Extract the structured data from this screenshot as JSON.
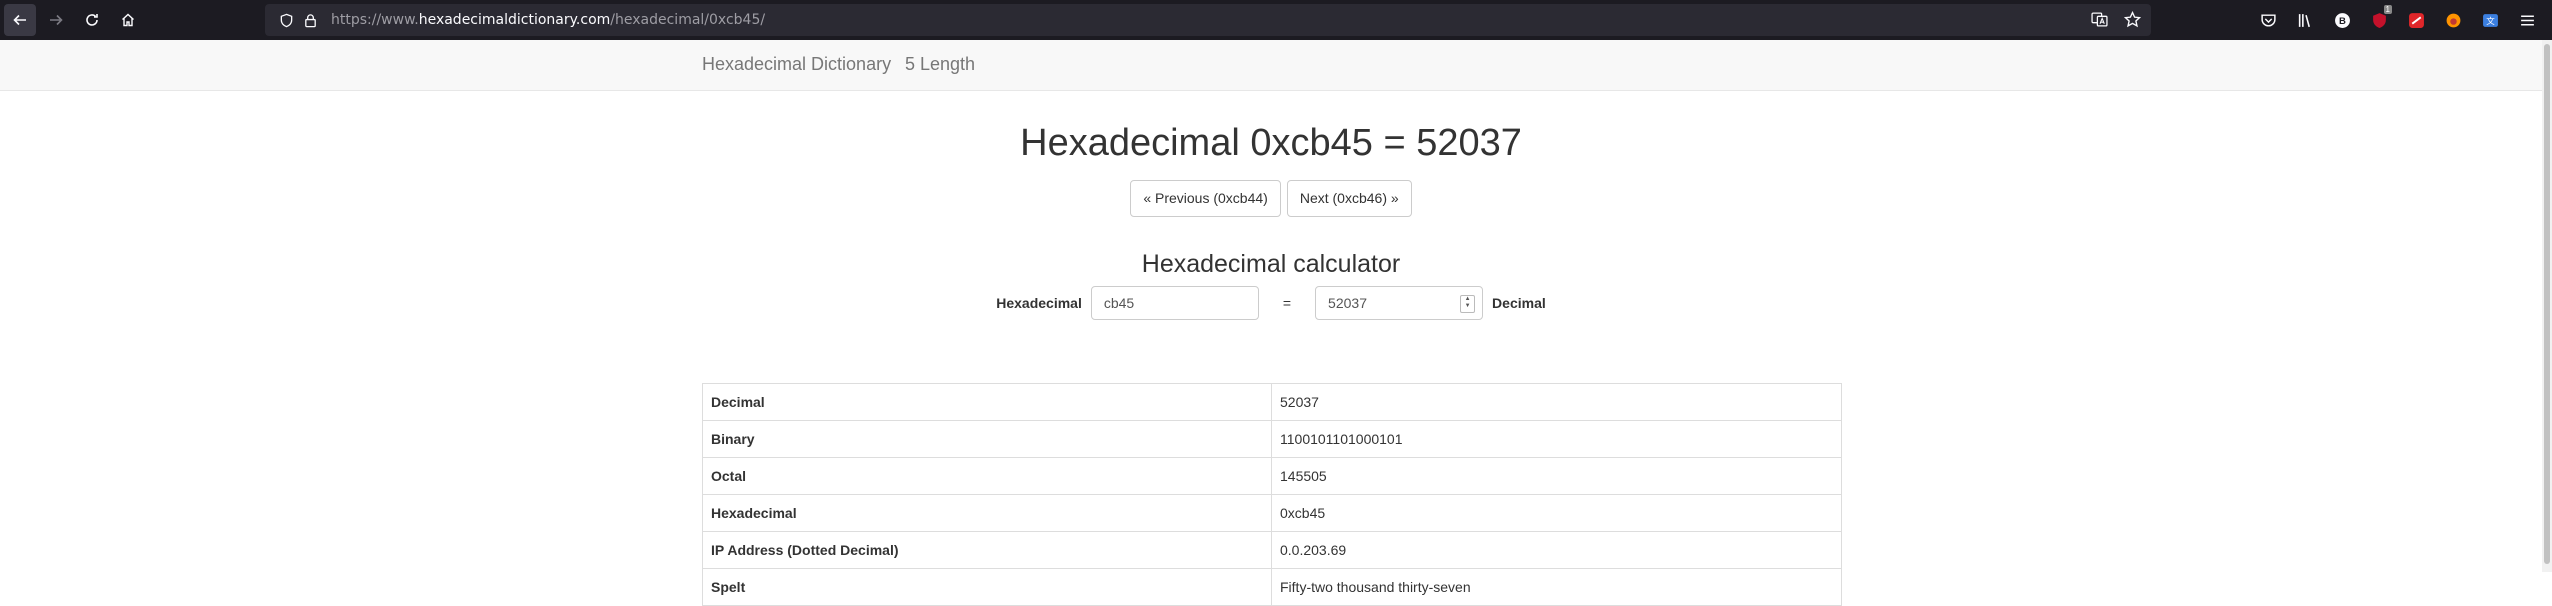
{
  "browser": {
    "url_prefix": "https://www.",
    "url_domain": "hexadecimaldictionary.com",
    "url_path": "/hexadecimal/0xcb45/",
    "extension_badge": "1"
  },
  "navbar": {
    "brand": "Hexadecimal Dictionary",
    "link": "5 Length"
  },
  "main": {
    "title": "Hexadecimal 0xcb45 = 52037",
    "prev_button": "« Previous (0xcb44)",
    "next_button": "Next (0xcb46) »"
  },
  "calculator": {
    "title": "Hexadecimal calculator",
    "hex_label": "Hexadecimal",
    "hex_value": "cb45",
    "equals": "=",
    "dec_value": "52037",
    "dec_label": "Decimal"
  },
  "table": {
    "rows": [
      {
        "label": "Decimal",
        "value": "52037"
      },
      {
        "label": "Binary",
        "value": "1100101101000101"
      },
      {
        "label": "Octal",
        "value": "145505"
      },
      {
        "label": "Hexadecimal",
        "value": "0xcb45"
      },
      {
        "label": "IP Address (Dotted Decimal)",
        "value": "0.0.203.69"
      },
      {
        "label": "Spelt",
        "value": "Fifty-two thousand thirty-seven"
      }
    ]
  }
}
